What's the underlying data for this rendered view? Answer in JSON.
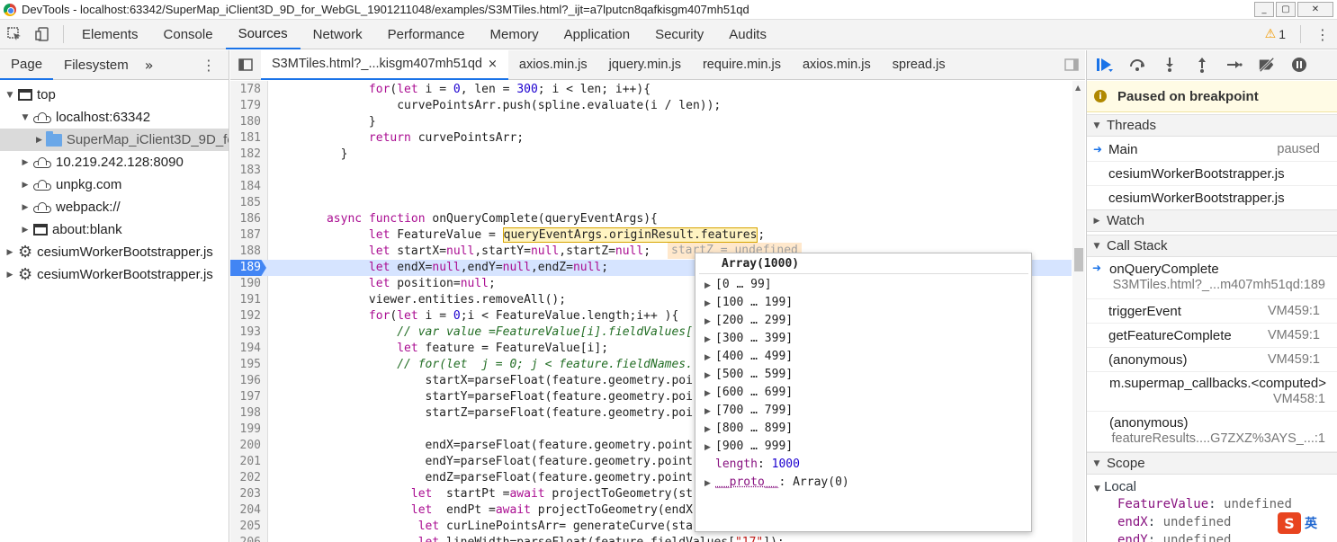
{
  "window": {
    "title": "DevTools - localhost:63342/SuperMap_iClient3D_9D_for_WebGL_1901211048/examples/S3MTiles.html?_ijt=a7lputcn8qafkisgm407mh51qd",
    "min_icon": "_",
    "max_icon": "▢",
    "close_icon": "✕"
  },
  "main_tabs": {
    "items": [
      "Elements",
      "Console",
      "Sources",
      "Network",
      "Performance",
      "Memory",
      "Application",
      "Security",
      "Audits"
    ],
    "active": "Sources",
    "warning_count": "1"
  },
  "navigator": {
    "tabs": [
      "Page",
      "Filesystem"
    ],
    "more": "»",
    "tree": [
      {
        "label": "top",
        "icon": "window-icon",
        "arrow": "▼",
        "indent": 0
      },
      {
        "label": "localhost:63342",
        "icon": "cloud-icon",
        "arrow": "▼",
        "indent": 1
      },
      {
        "label": "SuperMap_iClient3D_9D_fo",
        "icon": "folder-icon",
        "arrow": "▶",
        "indent": 2,
        "selected": true
      },
      {
        "label": "10.219.242.128:8090",
        "icon": "cloud-icon",
        "arrow": "▶",
        "indent": 1
      },
      {
        "label": "unpkg.com",
        "icon": "cloud-icon",
        "arrow": "▶",
        "indent": 1
      },
      {
        "label": "webpack://",
        "icon": "cloud-icon",
        "arrow": "▶",
        "indent": 1
      },
      {
        "label": "about:blank",
        "icon": "window-icon",
        "arrow": "▶",
        "indent": 1
      },
      {
        "label": "cesiumWorkerBootstrapper.js",
        "icon": "gear-icon",
        "arrow": "▶",
        "indent": 0
      },
      {
        "label": "cesiumWorkerBootstrapper.js",
        "icon": "gear-icon",
        "arrow": "▶",
        "indent": 0
      }
    ]
  },
  "editor": {
    "file_tabs": [
      "S3MTiles.html?_...kisgm407mh51qd",
      "axios.min.js",
      "jquery.min.js",
      "require.min.js",
      "axios.min.js",
      "spread.js"
    ],
    "active_tab": "S3MTiles.html?_...kisgm407mh51qd",
    "close_glyph": "×",
    "exec_line": "189",
    "inline_value": "startZ = undefined",
    "lines": [
      {
        "n": "178",
        "html": "            <span class='kw'>for</span>(<span class='kw'>let</span> i = <span class='nm'>0</span>, len = <span class='nm'>300</span>; i &lt; len; i++){"
      },
      {
        "n": "179",
        "html": "                curvePointsArr.push(spline.evaluate(i / len));"
      },
      {
        "n": "180",
        "html": "            }"
      },
      {
        "n": "181",
        "html": "            <span class='kw'>return</span> curvePointsArr;"
      },
      {
        "n": "182",
        "html": "        }"
      },
      {
        "n": "183",
        "html": ""
      },
      {
        "n": "184",
        "html": ""
      },
      {
        "n": "185",
        "html": ""
      },
      {
        "n": "186",
        "html": "      <span class='kw'>async</span> <span class='kw'>function</span> onQueryComplete(queryEventArgs){"
      },
      {
        "n": "187",
        "html": "            <span class='kw'>let</span> FeatureValue = <span class='hl'>queryEventArgs.originResult.features</span>;"
      },
      {
        "n": "188",
        "html": "            <span class='kw'>let</span> startX=<span class='kw'>null</span>,startY=<span class='kw'>null</span>,startZ=<span class='kw'>null</span>;"
      },
      {
        "n": "189",
        "html": "            <span class='kw'>let</span> endX=<span class='kw'>null</span>,endY=<span class='kw'>null</span>,endZ=<span class='kw'>null</span>;"
      },
      {
        "n": "190",
        "html": "            <span class='kw'>let</span> position=<span class='kw'>null</span>;"
      },
      {
        "n": "191",
        "html": "            viewer.entities.removeAll();"
      },
      {
        "n": "192",
        "html": "            <span class='kw'>for</span>(<span class='kw'>let</span> i = <span class='nm'>0</span>;i &lt; FeatureValue.length;i++ ){"
      },
      {
        "n": "193",
        "html": "                <span class='cm'>// var value =FeatureValue[i].fieldValues[</span>"
      },
      {
        "n": "194",
        "html": "                <span class='kw'>let</span> feature = FeatureValue[i];"
      },
      {
        "n": "195",
        "html": "                <span class='cm'>// for(let  j = 0; j &lt; feature.fieldNames.</span>"
      },
      {
        "n": "196",
        "html": "                    startX=parseFloat(feature.geometry.poi"
      },
      {
        "n": "197",
        "html": "                    startY=parseFloat(feature.geometry.poi"
      },
      {
        "n": "198",
        "html": "                    startZ=parseFloat(feature.geometry.poi"
      },
      {
        "n": "199",
        "html": ""
      },
      {
        "n": "200",
        "html": "                    endX=parseFloat(feature.geometry.point"
      },
      {
        "n": "201",
        "html": "                    endY=parseFloat(feature.geometry.point"
      },
      {
        "n": "202",
        "html": "                    endZ=parseFloat(feature.geometry.point"
      },
      {
        "n": "203",
        "html": "                  <span class='kw'>let</span>  startPt =<span class='kw'>await</span> projectToGeometry(st"
      },
      {
        "n": "204",
        "html": "                  <span class='kw'>let</span>  endPt =<span class='kw'>await</span> projectToGeometry(endX"
      },
      {
        "n": "205",
        "html": "                   <span class='kw'>let</span> curLinePointsArr= generateCurve(sta"
      },
      {
        "n": "206",
        "html": "                   <span class='kw'>let</span> lineWidth=parseFloat(feature.fieldValues[<span class='str'>\"17\"</span>]);"
      }
    ]
  },
  "popover": {
    "title": "Array(1000)",
    "ranges": [
      "[0 … 99]",
      "[100 … 199]",
      "[200 … 299]",
      "[300 … 399]",
      "[400 … 499]",
      "[500 … 599]",
      "[600 … 699]",
      "[700 … 799]",
      "[800 … 899]",
      "[900 … 999]"
    ],
    "length_key": "length",
    "length_value": "1000",
    "proto_key": "__proto__",
    "proto_value": "Array(0)"
  },
  "debugger": {
    "paused_label": "Paused on breakpoint",
    "threads_header": "Threads",
    "threads": [
      {
        "name": "Main",
        "status": "paused",
        "current": true
      },
      {
        "name": "cesiumWorkerBootstrapper.js",
        "status": ""
      },
      {
        "name": "cesiumWorkerBootstrapper.js",
        "status": ""
      }
    ],
    "watch_header": "Watch",
    "callstack_header": "Call Stack",
    "frames": [
      {
        "fn": "onQueryComplete",
        "loc": "S3MTiles.html?_...m407mh51qd:189",
        "current": true
      },
      {
        "fn": "triggerEvent",
        "loc": "VM459:1"
      },
      {
        "fn": "getFeatureComplete",
        "loc": "VM459:1"
      },
      {
        "fn": "(anonymous)",
        "loc": "VM459:1"
      },
      {
        "fn": "m.supermap_callbacks.<computed>",
        "loc": "VM458:1"
      },
      {
        "fn": "(anonymous)",
        "loc": "featureResults....G7ZXZ%3AYS_...:1"
      }
    ],
    "scope_header": "Scope",
    "local_header": "Local",
    "scope_vars": [
      {
        "k": "FeatureValue",
        "v": "undefined"
      },
      {
        "k": "endX",
        "v": "undefined"
      },
      {
        "k": "endY",
        "v": "undefined"
      }
    ]
  },
  "ime": {
    "badge": "S",
    "lang": "英"
  }
}
